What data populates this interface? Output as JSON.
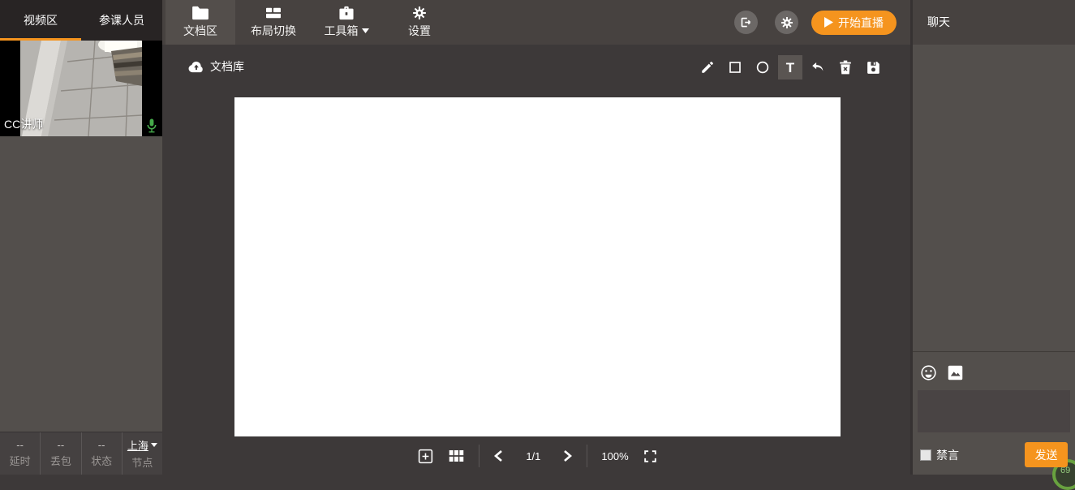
{
  "colors": {
    "accent_orange": "#f5941e",
    "mic_green": "#45a94a",
    "badge_green": "#68a23f",
    "topbar_bg": "#474240",
    "panel_bg": "#534f4c",
    "main_bg": "#3d3939"
  },
  "left_panel": {
    "tabs": [
      {
        "label": "视频区",
        "active": true
      },
      {
        "label": "参课人员",
        "active": false
      }
    ],
    "video": {
      "presenter_label": "CC讲师",
      "mic_icon": "microphone-icon"
    },
    "stats": [
      {
        "value": "--",
        "label": "延时"
      },
      {
        "value": "--",
        "label": "丢包"
      },
      {
        "value": "--",
        "label": "状态"
      },
      {
        "value": "上海",
        "label": "节点",
        "has_caret": true
      }
    ]
  },
  "top_bar": {
    "nav_items": [
      {
        "label": "文档区",
        "icon": "folder-icon",
        "active": true
      },
      {
        "label": "布局切换",
        "icon": "layout-icon",
        "active": false
      },
      {
        "label": "工具箱",
        "icon": "toolbox-icon",
        "active": false,
        "has_caret": true
      },
      {
        "label": "设置",
        "icon": "gear-icon",
        "active": false
      }
    ],
    "start_live_label": "开始直播"
  },
  "document_area": {
    "library_label": "文档库",
    "tools": {
      "text_glyph": "T",
      "active_tool": "text",
      "list": [
        "pencil",
        "rectangle",
        "ellipse",
        "text",
        "undo",
        "delete",
        "save"
      ]
    },
    "pager": {
      "page_text": "1/1",
      "zoom_text": "100%"
    }
  },
  "chat_panel": {
    "title": "聊天",
    "mute_label": "禁言",
    "send_label": "发送",
    "input_value": "",
    "badge_text": "69"
  }
}
